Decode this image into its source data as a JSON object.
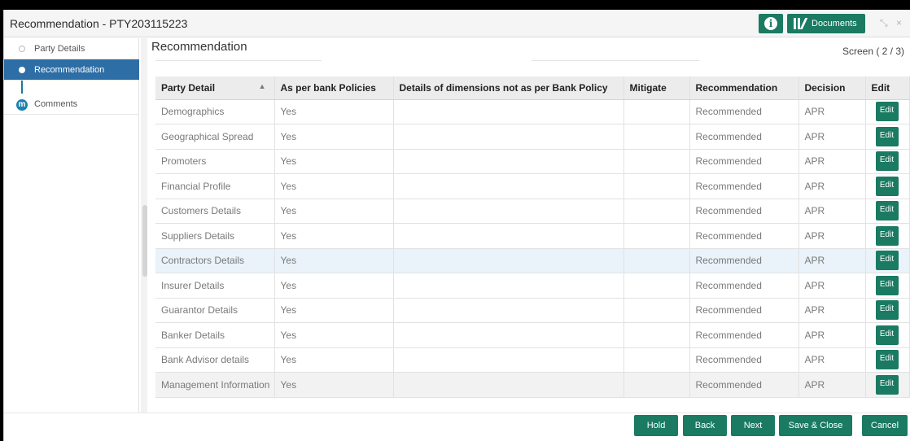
{
  "window": {
    "title": "Recommendation - PTY203115223"
  },
  "toolbar": {
    "documents_label": "Documents",
    "info_glyph": "i",
    "minimize_glyph": "⤡",
    "close_glyph": "×"
  },
  "sidebar": {
    "items": [
      {
        "label": "Party Details",
        "state": "done"
      },
      {
        "label": "Recommendation",
        "state": "active"
      },
      {
        "label": "Comments",
        "state": "pending"
      }
    ]
  },
  "main": {
    "section_title": "Recommendation",
    "screen_indicator": "Screen ( 2 / 3)",
    "table": {
      "columns": [
        "Party Detail",
        "As per bank Policies",
        "Details of dimensions not as per Bank Policy",
        "Mitigate",
        "Recommendation",
        "Decision",
        "Edit"
      ],
      "rows": [
        {
          "party": "Demographics",
          "policy": "Yes",
          "details": "",
          "mitigate": "",
          "recommendation": "Recommended",
          "decision": "APR",
          "edit": "Edit"
        },
        {
          "party": "Geographical Spread",
          "policy": "Yes",
          "details": "",
          "mitigate": "",
          "recommendation": "Recommended",
          "decision": "APR",
          "edit": "Edit"
        },
        {
          "party": "Promoters",
          "policy": "Yes",
          "details": "",
          "mitigate": "",
          "recommendation": "Recommended",
          "decision": "APR",
          "edit": "Edit"
        },
        {
          "party": "Financial Profile",
          "policy": "Yes",
          "details": "",
          "mitigate": "",
          "recommendation": "Recommended",
          "decision": "APR",
          "edit": "Edit"
        },
        {
          "party": "Customers Details",
          "policy": "Yes",
          "details": "",
          "mitigate": "",
          "recommendation": "Recommended",
          "decision": "APR",
          "edit": "Edit"
        },
        {
          "party": "Suppliers Details",
          "policy": "Yes",
          "details": "",
          "mitigate": "",
          "recommendation": "Recommended",
          "decision": "APR",
          "edit": "Edit"
        },
        {
          "party": "Contractors Details",
          "policy": "Yes",
          "details": "",
          "mitigate": "",
          "recommendation": "Recommended",
          "decision": "APR",
          "edit": "Edit"
        },
        {
          "party": "Insurer Details",
          "policy": "Yes",
          "details": "",
          "mitigate": "",
          "recommendation": "Recommended",
          "decision": "APR",
          "edit": "Edit"
        },
        {
          "party": "Guarantor Details",
          "policy": "Yes",
          "details": "",
          "mitigate": "",
          "recommendation": "Recommended",
          "decision": "APR",
          "edit": "Edit"
        },
        {
          "party": "Banker Details",
          "policy": "Yes",
          "details": "",
          "mitigate": "",
          "recommendation": "Recommended",
          "decision": "APR",
          "edit": "Edit"
        },
        {
          "party": "Bank Advisor details",
          "policy": "Yes",
          "details": "",
          "mitigate": "",
          "recommendation": "Recommended",
          "decision": "APR",
          "edit": "Edit"
        },
        {
          "party": "Management Information",
          "policy": "Yes",
          "details": "",
          "mitigate": "",
          "recommendation": "Recommended",
          "decision": "APR",
          "edit": "Edit"
        }
      ]
    }
  },
  "footer": {
    "hold": "Hold",
    "back": "Back",
    "next": "Next",
    "save_close": "Save & Close",
    "cancel": "Cancel"
  },
  "colors": {
    "accent": "#1a7a62",
    "sidebar_active": "#2e6ea6",
    "row_highlight": "#e9f3f9"
  }
}
